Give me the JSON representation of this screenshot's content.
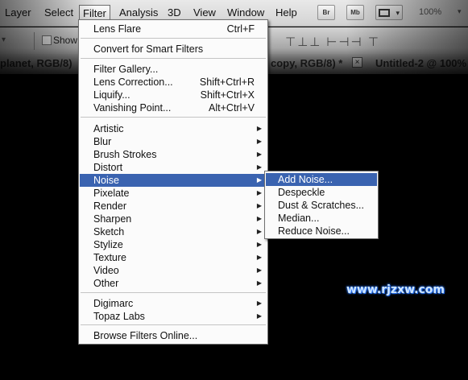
{
  "menubar": {
    "items": [
      "Layer",
      "Select",
      "Filter",
      "Analysis",
      "3D",
      "View",
      "Window",
      "Help"
    ],
    "active": "Filter",
    "buttons": [
      "Br",
      "Mb"
    ],
    "zoom": "100%"
  },
  "options_bar": {
    "show_label": "Show T"
  },
  "tabs": {
    "left_fragment": "planet, RGB/8)",
    "middle_fragment": "copy, RGB/8) *",
    "close_label": "×",
    "right_fragment": "Untitled-2 @ 100%"
  },
  "filter_menu": {
    "items": [
      {
        "label": "Lens Flare",
        "shortcut": "Ctrl+F"
      },
      {
        "label": "Convert for Smart Filters"
      },
      {
        "label": "Filter Gallery..."
      },
      {
        "label": "Lens Correction...",
        "shortcut": "Shift+Ctrl+R"
      },
      {
        "label": "Liquify...",
        "shortcut": "Shift+Ctrl+X"
      },
      {
        "label": "Vanishing Point...",
        "shortcut": "Alt+Ctrl+V"
      },
      {
        "label": "Artistic"
      },
      {
        "label": "Blur"
      },
      {
        "label": "Brush Strokes"
      },
      {
        "label": "Distort"
      },
      {
        "label": "Noise"
      },
      {
        "label": "Pixelate"
      },
      {
        "label": "Render"
      },
      {
        "label": "Sharpen"
      },
      {
        "label": "Sketch"
      },
      {
        "label": "Stylize"
      },
      {
        "label": "Texture"
      },
      {
        "label": "Video"
      },
      {
        "label": "Other"
      },
      {
        "label": "Digimarc"
      },
      {
        "label": "Topaz Labs"
      },
      {
        "label": "Browse Filters Online..."
      }
    ],
    "submenu_arrow": "▶"
  },
  "noise_submenu": {
    "items": [
      "Add Noise...",
      "Despeckle",
      "Dust & Scratches...",
      "Median...",
      "Reduce Noise..."
    ],
    "highlighted": "Add Noise..."
  },
  "watermark": "www.rjzxw.com",
  "colors": {
    "highlight": "#3a63b0",
    "menu_bg": "#fbfbfb",
    "canvas": "#000000"
  }
}
